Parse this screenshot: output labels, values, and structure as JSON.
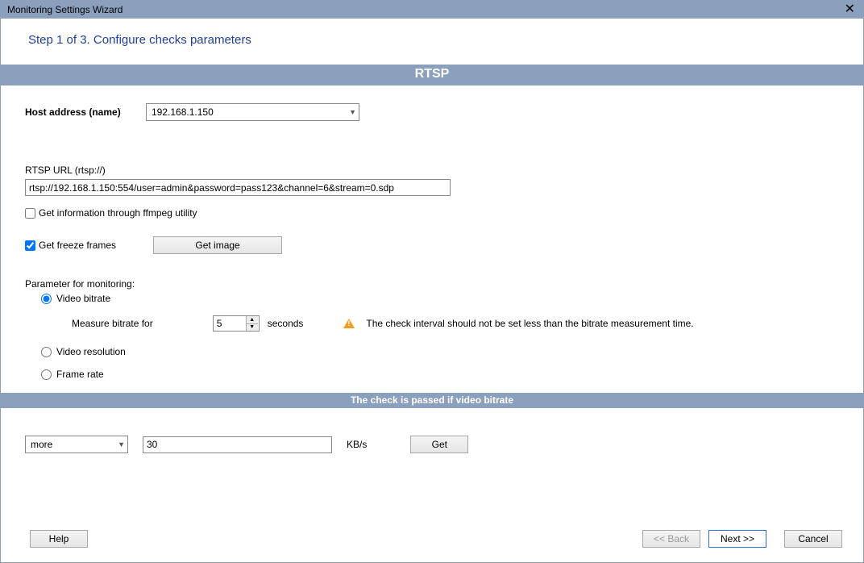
{
  "window": {
    "title": "Monitoring Settings Wizard"
  },
  "step": {
    "heading": "Step 1 of 3. Configure checks parameters"
  },
  "section": {
    "title": "RTSP"
  },
  "host": {
    "label": "Host address (name)",
    "value": "192.168.1.150"
  },
  "rtsp": {
    "url_label": "RTSP URL (rtsp://)",
    "url_value": "rtsp://192.168.1.150:554/user=admin&password=pass123&channel=6&stream=0.sdp"
  },
  "options": {
    "ffmpeg_label": "Get information through ffmpeg utility",
    "ffmpeg_checked": false,
    "freeze_label": "Get freeze frames",
    "freeze_checked": true,
    "get_image_btn": "Get image"
  },
  "monitoring": {
    "group_label": "Parameter for monitoring:",
    "video_bitrate_label": "Video bitrate",
    "video_resolution_label": "Video resolution",
    "frame_rate_label": "Frame rate",
    "selected": "video_bitrate",
    "measure_label": "Measure bitrate for",
    "measure_value": "5",
    "measure_unit": "seconds",
    "warning_text": "The check interval should not be set less than the bitrate measurement time."
  },
  "pass": {
    "band_title": "The check is passed if video bitrate",
    "operator": "more",
    "value": "30",
    "unit": "KB/s",
    "get_btn": "Get"
  },
  "footer": {
    "help": "Help",
    "back": "<< Back",
    "next": "Next >>",
    "cancel": "Cancel"
  }
}
